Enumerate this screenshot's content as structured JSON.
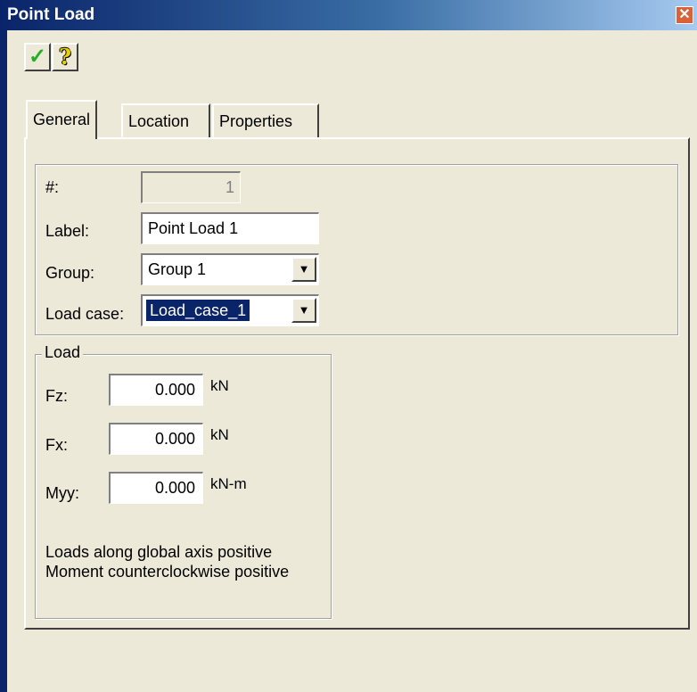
{
  "window": {
    "title": "Point Load",
    "close_glyph": "✕"
  },
  "toolbar": {
    "ok_glyph": "✓",
    "help_glyph": "?"
  },
  "tabs": [
    {
      "label": "General",
      "selected": true
    },
    {
      "label": "Location",
      "selected": false
    },
    {
      "label": "Properties",
      "selected": false
    }
  ],
  "general": {
    "number": {
      "label": "#:",
      "value": "1"
    },
    "label_field": {
      "label": "Label:",
      "value": "Point Load 1"
    },
    "group": {
      "label": "Group:",
      "value": "Group 1"
    },
    "load_case": {
      "label": "Load case:",
      "value": "Load_case_1"
    }
  },
  "load": {
    "title": "Load",
    "fz": {
      "label": "Fz:",
      "value": "0.000",
      "unit": "kN"
    },
    "fx": {
      "label": "Fx:",
      "value": "0.000",
      "unit": "kN"
    },
    "myy": {
      "label": "Myy:",
      "value": "0.000",
      "unit": "kN-m"
    },
    "note": "Loads along global axis positive Moment counterclockwise positive"
  },
  "icons": {
    "ok": "checkmark-icon",
    "help": "help-icon",
    "close": "close-icon",
    "dropdown": "dropdown-arrow-icon"
  },
  "colors": {
    "title_bar": "#0A246A",
    "dialog_face": "#ECE9D8",
    "selection": "#0A246A",
    "ok_green": "#22B022",
    "help_yellow": "#E8D000"
  }
}
